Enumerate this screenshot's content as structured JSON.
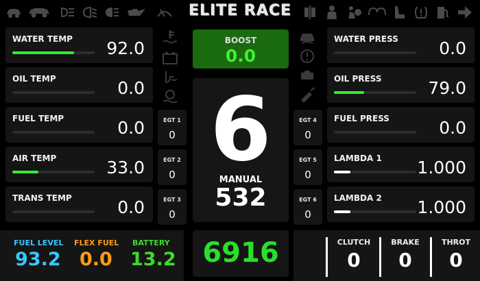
{
  "header": {
    "title": "ELITE RACE",
    "left_icons": [
      "car-icon",
      "drive-car-icon",
      "fog-light-icon",
      "low-beam-icon",
      "high-beam-icon",
      "oil-can-icon",
      "wiper-icon"
    ],
    "right_icons": [
      "brake-pad-icon",
      "seatbelt-person-icon",
      "airbag-icon",
      "glow-plug-icon",
      "seat-icon",
      "tire-pressure-icon",
      "fuel-pump-icon",
      "turn-right-arrow-icon"
    ]
  },
  "left_gauges": [
    {
      "label": "WATER TEMP",
      "value": "92.0",
      "fill_pct": 75,
      "fill_color": "#2ef02a"
    },
    {
      "label": "OIL TEMP",
      "value": "0.0",
      "fill_pct": 0,
      "fill_color": "#2ef02a"
    },
    {
      "label": "FUEL TEMP",
      "value": "0.0",
      "fill_pct": 0,
      "fill_color": "#2ef02a"
    },
    {
      "label": "AIR TEMP",
      "value": "33.0",
      "fill_pct": 32,
      "fill_color": "#2ef02a"
    },
    {
      "label": "TRANS TEMP",
      "value": "0.0",
      "fill_pct": 0,
      "fill_color": "#2ef02a"
    }
  ],
  "right_gauges": [
    {
      "label": "WATER PRESS",
      "value": "0.0",
      "fill_pct": 0,
      "fill_color": "#2ef02a"
    },
    {
      "label": "OIL PRESS",
      "value": "79.0",
      "fill_pct": 37,
      "fill_color": "#2ef02a"
    },
    {
      "label": "FUEL PRESS",
      "value": "0.0",
      "fill_pct": 0,
      "fill_color": "#2ef02a"
    },
    {
      "label": "LAMBDA 1",
      "value": "1.000",
      "fill_pct": 20,
      "fill_color": "#ffffff"
    },
    {
      "label": "LAMBDA 2",
      "value": "1.000",
      "fill_pct": 20,
      "fill_color": "#ffffff"
    }
  ],
  "egt_left": [
    {
      "label": "EGT 1",
      "value": "0"
    },
    {
      "label": "EGT 2",
      "value": "0"
    },
    {
      "label": "EGT 3",
      "value": "0"
    }
  ],
  "egt_right": [
    {
      "label": "EGT 4",
      "value": "0"
    },
    {
      "label": "EGT 5",
      "value": "0"
    },
    {
      "label": "EGT 6",
      "value": "0"
    }
  ],
  "boost": {
    "label": "BOOST",
    "value": "0.0"
  },
  "gear": {
    "value": "6",
    "mode": "MANUAL",
    "speed": "532"
  },
  "rpm": {
    "value": "6916"
  },
  "bottom_left": [
    {
      "label": "FUEL LEVEL",
      "value": "93.2",
      "color": "#36c9ff"
    },
    {
      "label": "FLEX FUEL",
      "value": "0.0",
      "color": "#ff9a1a"
    },
    {
      "label": "BATTERY",
      "value": "13.2",
      "color": "#3fd92e"
    }
  ],
  "pedals": [
    {
      "label": "CLUTCH",
      "value": "0"
    },
    {
      "label": "BRAKE",
      "value": "0"
    },
    {
      "label": "THROT",
      "value": "0"
    }
  ],
  "side_icons_left": [
    "coolant-temp-icon",
    "battery-icon",
    "oil-temp-icon",
    "trans-temp-icon"
  ],
  "side_icons_right": [
    "abs-car-icon",
    "warning-circle-icon",
    "engine-icon",
    "fuel-filter-icon"
  ]
}
